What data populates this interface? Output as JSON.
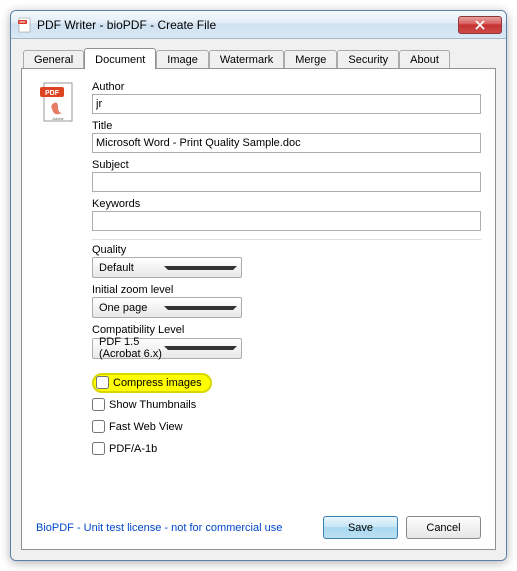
{
  "window": {
    "title": "PDF Writer - bioPDF - Create File"
  },
  "tabs": {
    "general": "General",
    "document": "Document",
    "image": "Image",
    "watermark": "Watermark",
    "merge": "Merge",
    "security": "Security",
    "about": "About",
    "active": "document"
  },
  "fields": {
    "author_label": "Author",
    "author_value": "jr",
    "title_label": "Title",
    "title_value": "Microsoft Word - Print Quality Sample.doc",
    "subject_label": "Subject",
    "subject_value": "",
    "keywords_label": "Keywords",
    "keywords_value": "",
    "quality_label": "Quality",
    "quality_value": "Default",
    "zoom_label": "Initial zoom level",
    "zoom_value": "One page",
    "compat_label": "Compatibility Level",
    "compat_value": "PDF 1.5 (Acrobat 6.x)"
  },
  "checkboxes": {
    "compress": "Compress images",
    "thumbnails": "Show Thumbnails",
    "fastweb": "Fast Web View",
    "pdfa": "PDF/A-1b"
  },
  "footer": {
    "license": "BioPDF - Unit test license - not for commercial use",
    "save": "Save",
    "cancel": "Cancel"
  }
}
